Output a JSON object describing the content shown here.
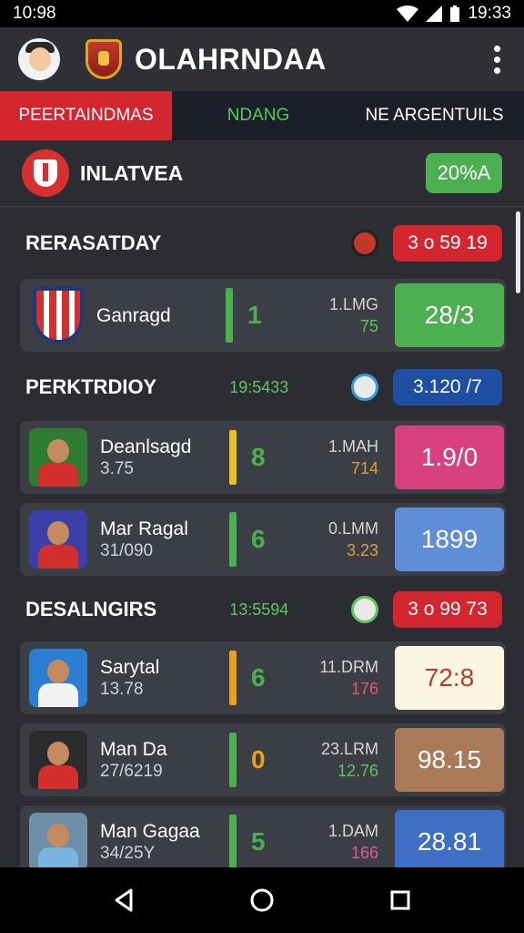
{
  "status": {
    "left_time": "10:98",
    "right_time": "19:33"
  },
  "app": {
    "title": "OLAHRNDAA"
  },
  "tabs": [
    {
      "label": "PEERTAINDMAS",
      "active": true
    },
    {
      "label": "NDANG",
      "active": false
    },
    {
      "label": "NE ARGENTUILS",
      "active": false
    }
  ],
  "league": {
    "name": "INLATVEA",
    "badge": "20%A"
  },
  "sections": [
    {
      "title": "RERASATDAY",
      "meta": "",
      "badge": "3 o 59 19",
      "badge_color": "#d3262e",
      "rows": [
        {
          "name": "Ganragd",
          "sub": "",
          "score": "1",
          "stat1": "1.LMG",
          "stat2": "75",
          "stat2_color": "#5fc65b",
          "value": "28/3",
          "value_bg": "#4caf50",
          "value_color": "#ffffff",
          "bar_color": "#4caf50",
          "score_color": "#4caf50",
          "thumb": "shield"
        }
      ]
    },
    {
      "title": "PERKTRDIOY",
      "meta": "19:5433",
      "badge": "3.120 /7",
      "badge_color": "#1e4fa3",
      "rows": [
        {
          "name": "Deanlsagd",
          "sub": "3.75",
          "score": "8",
          "stat1": "1.MAH",
          "stat2": "714",
          "stat2_color": "#e0a030",
          "value": "1.9/0",
          "value_bg": "#d9407f",
          "value_color": "#ffffff",
          "bar_color": "#e6c229",
          "score_color": "#4caf50",
          "thumb": "player-red"
        },
        {
          "name": "Mar Ragal",
          "sub": "31/090",
          "score": "6",
          "stat1": "0.LMM",
          "stat2": "3.23",
          "stat2_color": "#e0a030",
          "value": "1899",
          "value_bg": "#5e8fd6",
          "value_color": "#ffffff",
          "bar_color": "#4caf50",
          "score_color": "#4caf50",
          "thumb": "player-blue"
        }
      ]
    },
    {
      "title": "DESALNGIRS",
      "meta": "13:5594",
      "badge": "3 o 99 73",
      "badge_color": "#d3262e",
      "rows": [
        {
          "name": "Sarytal",
          "sub": "13.78",
          "score": "6",
          "stat1": "11.DRM",
          "stat2": "176",
          "stat2_color": "#e05a6a",
          "value": "72:8",
          "value_bg": "#fbf6e2",
          "value_color": "#c0392b",
          "bar_color": "#e8a020",
          "score_color": "#4caf50",
          "thumb": "player-white"
        },
        {
          "name": "Man Da",
          "sub": "27/6219",
          "score": "0",
          "stat1": "23.LRM",
          "stat2": "12.76",
          "stat2_color": "#5fc65b",
          "value": "98.15",
          "value_bg": "#a97a57",
          "value_color": "#ffffff",
          "bar_color": "#4caf50",
          "score_color": "#e8a020",
          "thumb": "player-red"
        },
        {
          "name": "Man Gagaa",
          "sub": "34/25Y",
          "score": "5",
          "stat1": "1.DAM",
          "stat2": "166",
          "stat2_color": "#e05a9a",
          "value": "28.81",
          "value_bg": "#3f6fc4",
          "value_color": "#ffffff",
          "bar_color": "#4caf50",
          "score_color": "#4caf50",
          "thumb": "player-sky"
        }
      ]
    }
  ],
  "icons": {
    "menu": "more-vert-icon",
    "back": "back-triangle-icon",
    "home": "home-circle-icon",
    "recents": "recents-square-icon"
  }
}
